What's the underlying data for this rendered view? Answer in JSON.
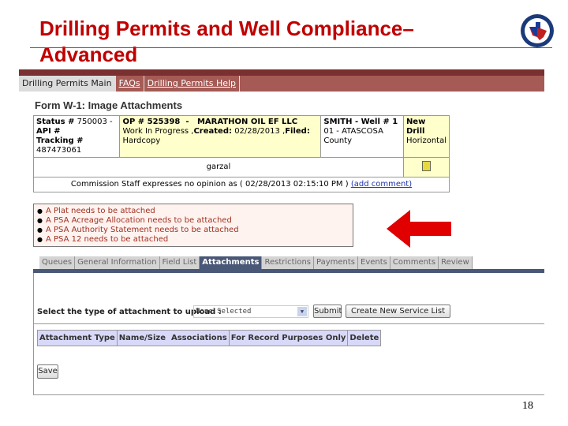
{
  "slide": {
    "title": "Drilling Permits and Well Compliance– Advanced",
    "page_number": "18"
  },
  "nav": {
    "items": [
      "Drilling Permits Main",
      "FAQs",
      "Drilling Permits Help"
    ]
  },
  "form": {
    "title": "Form W-1: Image Attachments",
    "status_label": "Status #",
    "status_value": "750003 -",
    "api_label": "API #",
    "tracking_label": "Tracking #",
    "tracking_value": "487473061",
    "op_line": "OP # 525398  -   MARATHON OIL EF LLC",
    "wip": "Work In Progress ,",
    "created_label": "Created:",
    "created_value": "02/28/2013 ,",
    "filed_label": "Filed:",
    "filed_value": "Hardcopy",
    "well": "SMITH - Well # 1",
    "county": "01 - ATASCOSA County",
    "type1": "New Drill",
    "type2": "Horizontal",
    "user": "garzal",
    "comment": "Commission Staff expresses no opinion as ( 02/28/2013 02:15:10 PM ) ",
    "add_comment": "(add comment)"
  },
  "warnings": [
    "A Plat needs to be attached",
    "A PSA Acreage Allocation needs to be attached",
    "A PSA Authority Statement needs to be attached",
    "A PSA 12 needs to be attached"
  ],
  "tabs": [
    "Queues",
    "General Information",
    "Field List",
    "Attachments",
    "Restrictions",
    "Payments",
    "Events",
    "Comments",
    "Review"
  ],
  "active_tab": "Attachments",
  "upload": {
    "label": "Select the type of attachment to upload :",
    "select_value": "None Selected",
    "submit": "Submit",
    "create_service_list": "Create New Service List"
  },
  "attachments_table": {
    "headers": [
      "Attachment Type",
      "Name/Size  Associations",
      "For Record Purposes Only",
      "Delete"
    ]
  },
  "save": "Save",
  "colors": {
    "title": "#c00000",
    "nav": "#a55a55",
    "tab_active": "#4a5878",
    "arrow": "#e00000"
  }
}
